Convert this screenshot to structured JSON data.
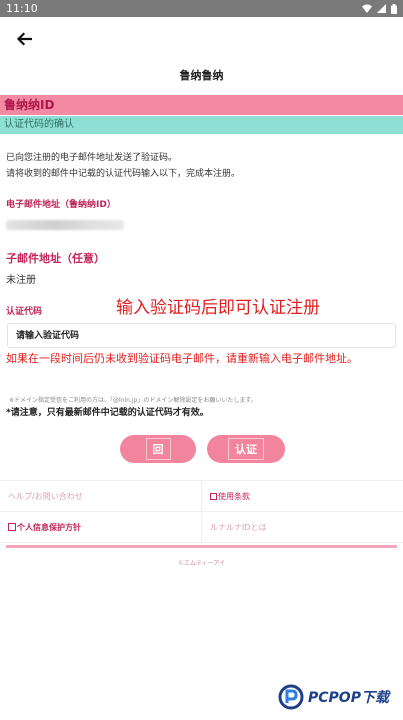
{
  "status_bar": {
    "time": "11:10"
  },
  "header": {
    "title": "鲁纳鲁纳"
  },
  "bands": {
    "id_title": "鲁纳纳ID",
    "confirm_title": "认证代码的确认"
  },
  "intro": {
    "line1": "已向您注册的电子邮件地址发送了验证码。",
    "line2": "请将收到的邮件中记载的认证代码输入以下，完成本注册。"
  },
  "email_section": {
    "label": "电子邮件地址（鲁纳纳ID）"
  },
  "sub_email": {
    "label": "子邮件地址（任意）",
    "value": "未注册"
  },
  "code": {
    "label": "认证代码",
    "placeholder": "请输入验证代码"
  },
  "overlays": {
    "hint_top": "输入验证码后即可认证注册",
    "hint_bottom": "如果在一段时间后仍未收到验证码电子邮件，请重新输入电子邮件地址。"
  },
  "notes": {
    "domain_note": "※ドメイン指定受信をご利用の方は、「@lnln.jp」のドメイン解除設定をお願いいたします。",
    "latest_code": "*请注意，只有最新邮件中记载的认证代码才有效。"
  },
  "buttons": {
    "back": "回",
    "auth": "认证"
  },
  "links": {
    "help": "ヘルプ/お問い合わせ",
    "terms": "使用条款",
    "privacy": "个人信息保护方针",
    "about_id": "ルナルナIDとは"
  },
  "footer": {
    "copyright": "©エムティーアイ"
  },
  "watermark": {
    "text": "PCPOP下载"
  },
  "colors": {
    "accent_pink": "#f2859d",
    "band_pink": "#f28aa3",
    "band_teal": "#8fe0d4",
    "label_red": "#c0245a",
    "overlay_red": "#e02020"
  }
}
